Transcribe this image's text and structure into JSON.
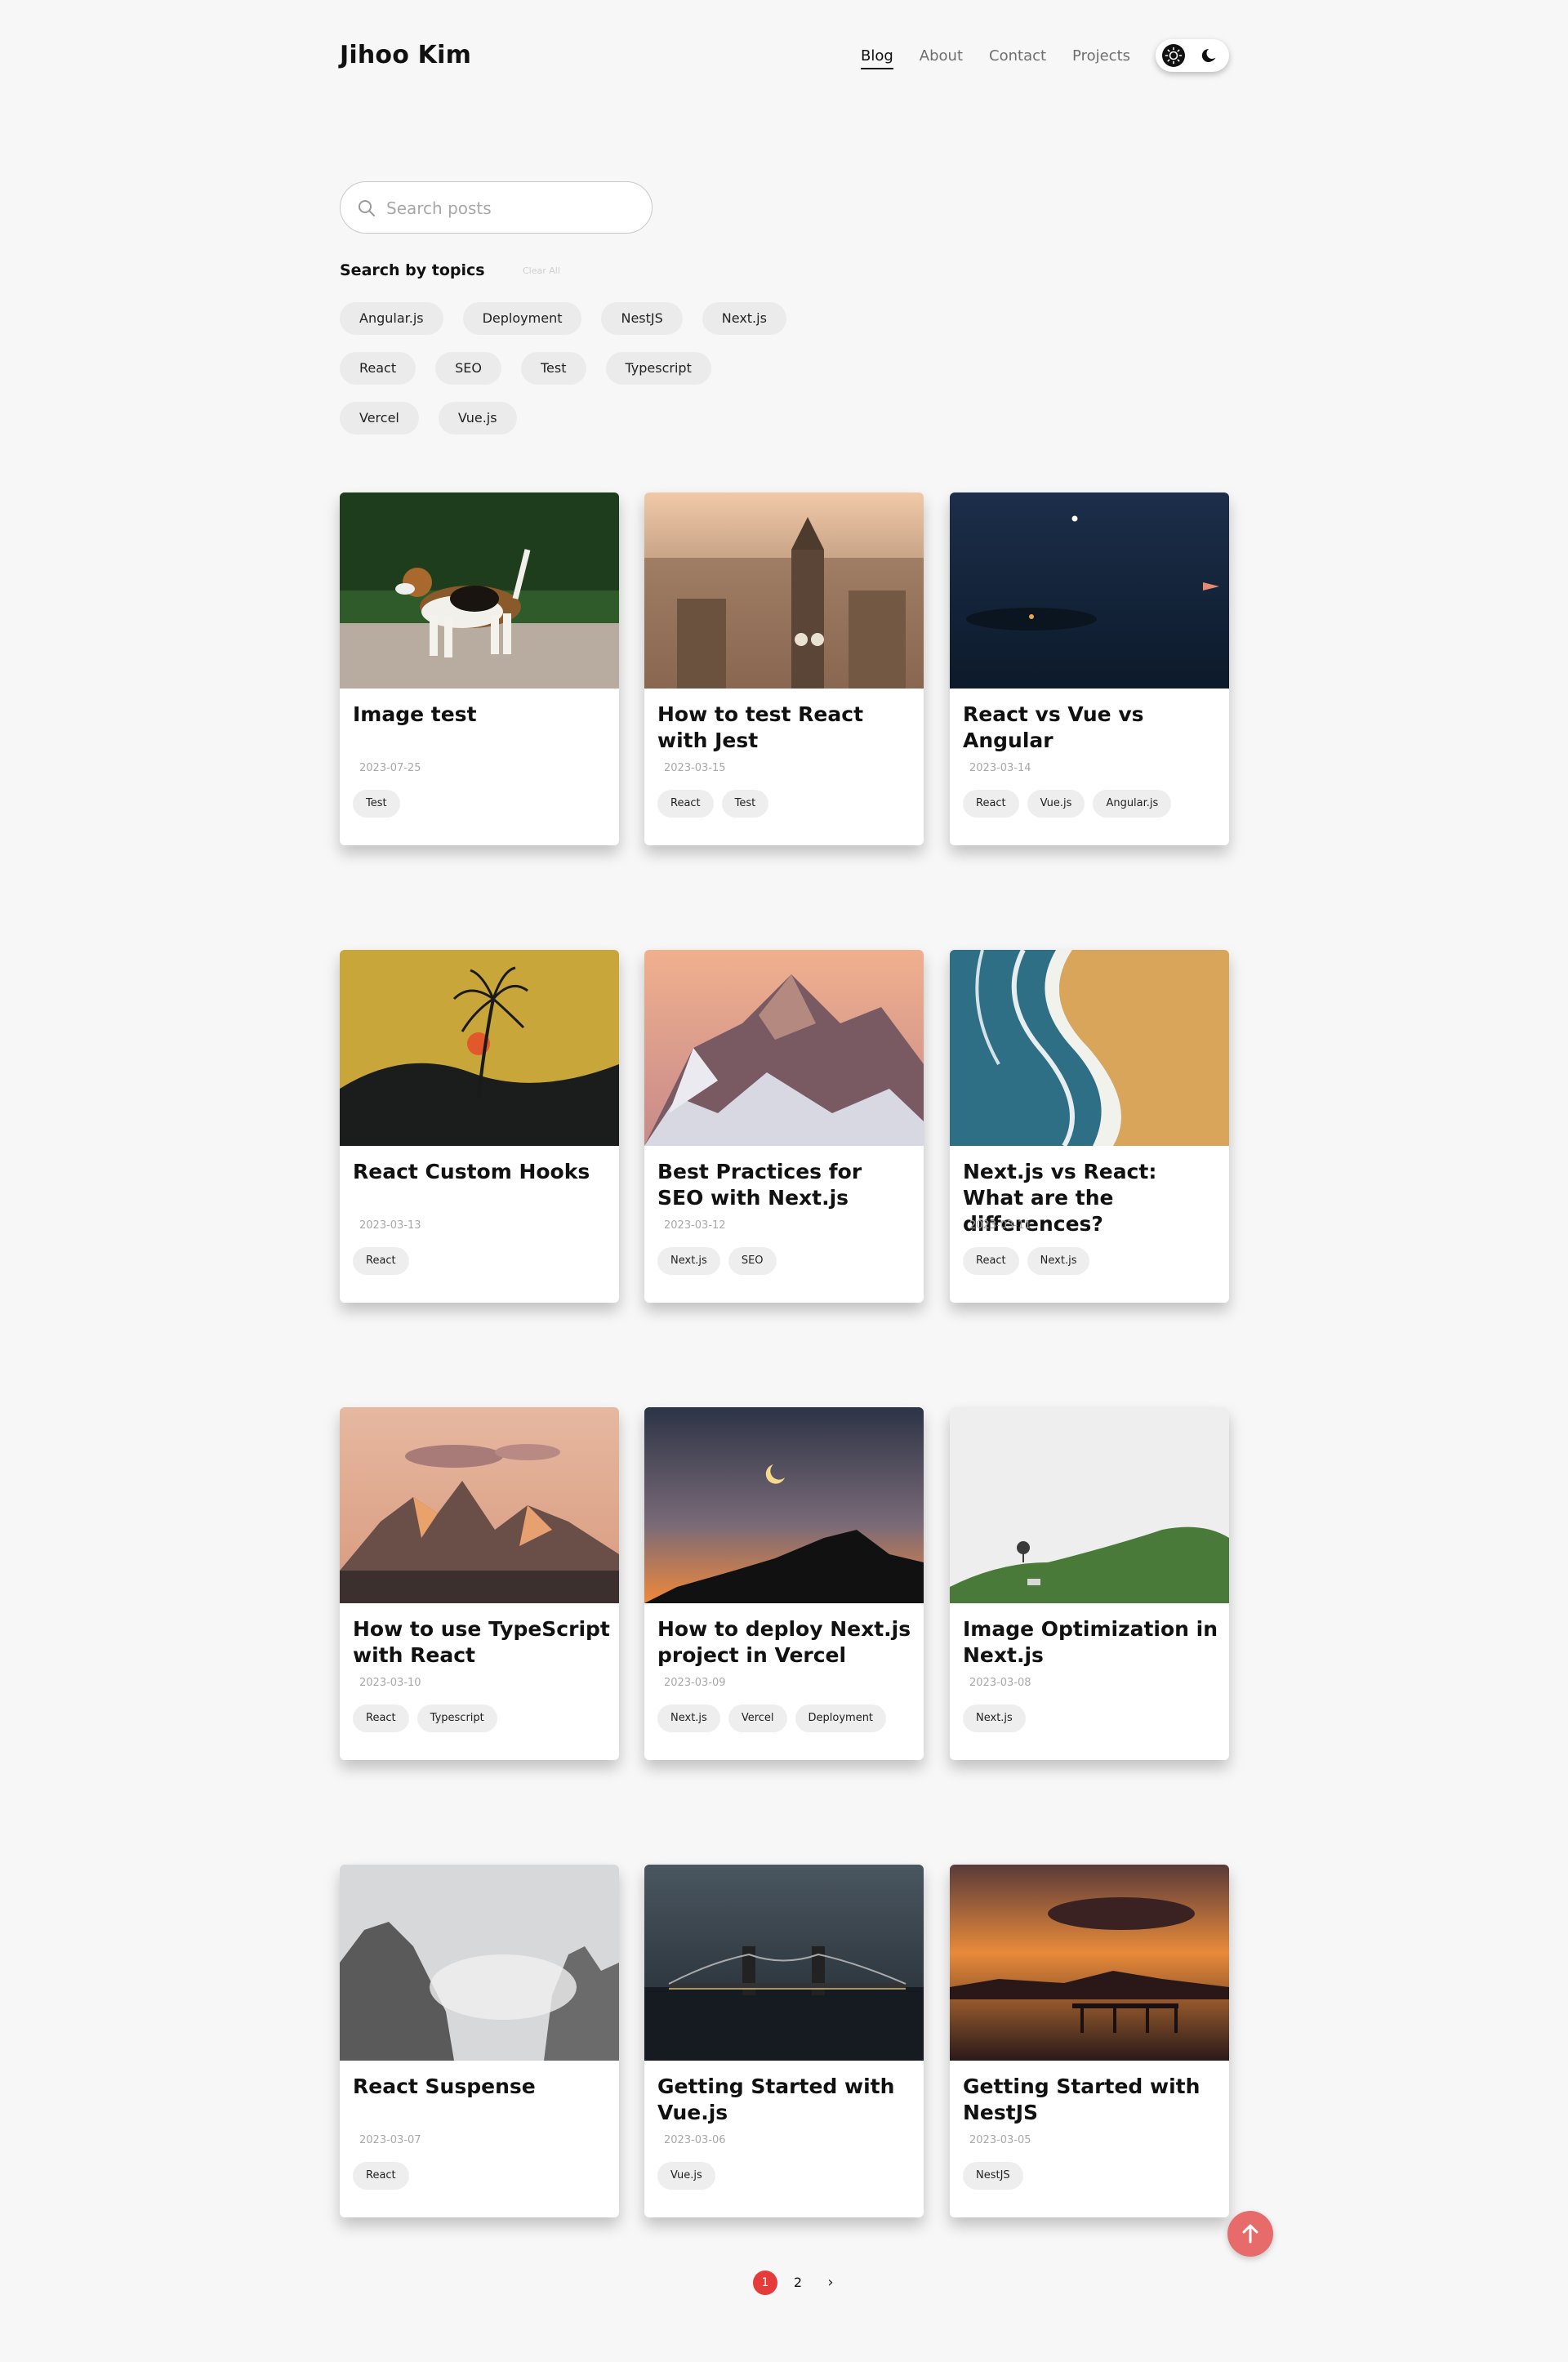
{
  "header": {
    "brand": "Jihoo Kim",
    "nav": [
      "Blog",
      "About",
      "Contact",
      "Projects"
    ],
    "active_nav": "Blog"
  },
  "search": {
    "placeholder": "Search posts",
    "value": ""
  },
  "topics": {
    "title": "Search by topics",
    "clear_label": "Clear All",
    "rows": [
      [
        "Angular.js",
        "Deployment",
        "NestJS",
        "Next.js"
      ],
      [
        "React",
        "SEO",
        "Test",
        "Typescript"
      ],
      [
        "Vercel",
        "Vue.js"
      ]
    ]
  },
  "posts": [
    {
      "title": "Image test",
      "date": "2023-07-25",
      "tags": [
        "Test"
      ]
    },
    {
      "title": "How to test React with Jest",
      "date": "2023-03-15",
      "tags": [
        "React",
        "Test"
      ]
    },
    {
      "title": "React vs Vue vs Angular",
      "date": "2023-03-14",
      "tags": [
        "React",
        "Vue.js",
        "Angular.js"
      ]
    },
    {
      "title": "React Custom Hooks",
      "date": "2023-03-13",
      "tags": [
        "React"
      ]
    },
    {
      "title": "Best Practices for SEO with Next.js",
      "date": "2023-03-12",
      "tags": [
        "Next.js",
        "SEO"
      ]
    },
    {
      "title": "Next.js vs React: What are the differences?",
      "date": "2023-03-11",
      "tags": [
        "React",
        "Next.js"
      ]
    },
    {
      "title": "How to use TypeScript with React",
      "date": "2023-03-10",
      "tags": [
        "React",
        "Typescript"
      ]
    },
    {
      "title": "How to deploy Next.js project in Vercel",
      "date": "2023-03-09",
      "tags": [
        "Next.js",
        "Vercel",
        "Deployment"
      ]
    },
    {
      "title": "Image Optimization in Next.js",
      "date": "2023-03-08",
      "tags": [
        "Next.js"
      ]
    },
    {
      "title": "React Suspense",
      "date": "2023-03-07",
      "tags": [
        "React"
      ]
    },
    {
      "title": "Getting Started with Vue.js",
      "date": "2023-03-06",
      "tags": [
        "Vue.js"
      ]
    },
    {
      "title": "Getting Started with NestJS",
      "date": "2023-03-05",
      "tags": [
        "NestJS"
      ]
    }
  ],
  "pagination": {
    "pages": [
      "1",
      "2"
    ],
    "current": "1",
    "next": "›"
  },
  "colors": {
    "accent": "#e53b3b",
    "scroll_top": "#e86b6b"
  }
}
